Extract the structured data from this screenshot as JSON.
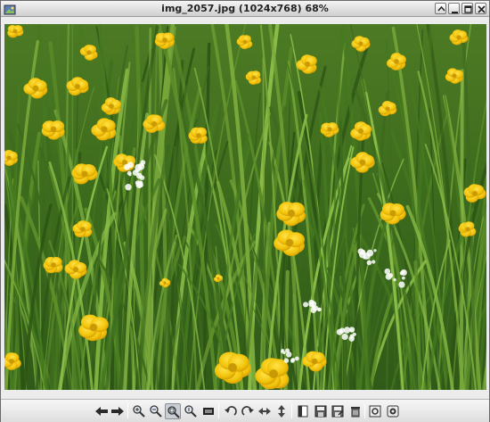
{
  "window": {
    "title": "img_2057.jpg (1024x768) 68%",
    "controls": [
      "shade-icon",
      "minimize-icon",
      "maximize-icon",
      "close-icon"
    ]
  },
  "image": {
    "subject": "photo",
    "colors": {
      "grass": "#3d6a1e",
      "grass_light": "#7aa83a",
      "flower": "#f2c40a",
      "clover": "#ffffff"
    }
  },
  "toolbar": {
    "buttons": [
      {
        "name": "previous-image-button",
        "icon": "arrow-left-icon"
      },
      {
        "name": "next-image-button",
        "icon": "arrow-right-icon"
      },
      {
        "name": "zoom-in-button",
        "icon": "zoom-in-icon"
      },
      {
        "name": "zoom-out-button",
        "icon": "zoom-out-icon"
      },
      {
        "name": "zoom-fit-button",
        "icon": "zoom-fit-icon",
        "active": true
      },
      {
        "name": "zoom-original-button",
        "icon": "zoom-original-icon"
      },
      {
        "name": "fullscreen-button",
        "icon": "fullscreen-icon"
      },
      {
        "name": "rotate-left-button",
        "icon": "rotate-left-icon"
      },
      {
        "name": "rotate-right-button",
        "icon": "rotate-right-icon"
      },
      {
        "name": "flip-horizontal-button",
        "icon": "flip-horizontal-icon"
      },
      {
        "name": "flip-vertical-button",
        "icon": "flip-vertical-icon"
      },
      {
        "name": "open-file-button",
        "icon": "open-file-icon"
      },
      {
        "name": "save-button",
        "icon": "save-icon"
      },
      {
        "name": "save-as-button",
        "icon": "save-as-icon"
      },
      {
        "name": "delete-button",
        "icon": "trash-icon"
      },
      {
        "name": "preferences-button",
        "icon": "preferences-icon"
      },
      {
        "name": "quit-button",
        "icon": "power-icon"
      }
    ]
  }
}
